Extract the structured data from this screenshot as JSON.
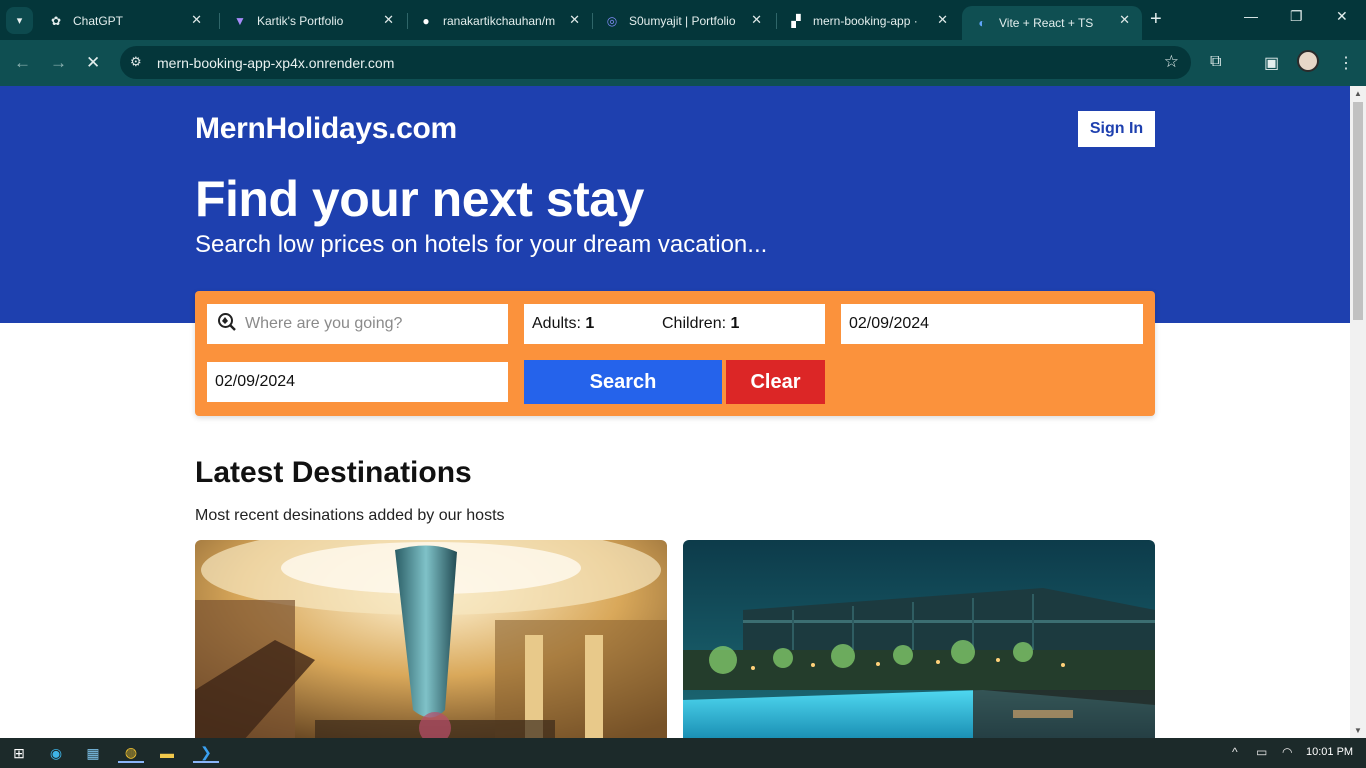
{
  "browser": {
    "tabs": [
      {
        "title": "ChatGPT",
        "icon": "chatgpt-icon"
      },
      {
        "title": "Kartik's Portfolio",
        "icon": "vite-icon"
      },
      {
        "title": "ranakartikchauhan/m",
        "icon": "github-icon"
      },
      {
        "title": "S0umyajit | Portfolio",
        "icon": "portfolio-icon"
      },
      {
        "title": "mern-booking-app ·",
        "icon": "render-icon"
      },
      {
        "title": "Vite + React + TS",
        "icon": "loading-icon"
      }
    ],
    "active_tab_index": 5,
    "url": "mern-booking-app-xp4x.onrender.com"
  },
  "page": {
    "logo": "MernHolidays.com",
    "sign_in": "Sign In",
    "headline": "Find your next stay",
    "subhead": "Search low prices on hotels for your dream vacation...",
    "search": {
      "destination_placeholder": "Where are you going?",
      "adults_label": "Adults:",
      "adults_value": "1",
      "children_label": "Children:",
      "children_value": "1",
      "check_in": "02/09/2024",
      "check_out": "02/09/2024",
      "search_button": "Search",
      "clear_button": "Clear"
    },
    "section_title": "Latest Destinations",
    "section_subtitle": "Most recent desinations added by our hosts",
    "cards": [
      {
        "image": "hotel-lobby-image"
      },
      {
        "image": "rooftop-pool-image"
      }
    ],
    "colors": {
      "hero": "#1e40af",
      "search_panel": "#fb923c",
      "search_button": "#2563eb",
      "clear_button": "#dc2626"
    }
  },
  "taskbar": {
    "apps": [
      "windows-start-icon",
      "edge-icon",
      "store-icon",
      "chrome-icon",
      "file-explorer-icon",
      "vscode-icon"
    ],
    "time": "10:01 PM"
  }
}
